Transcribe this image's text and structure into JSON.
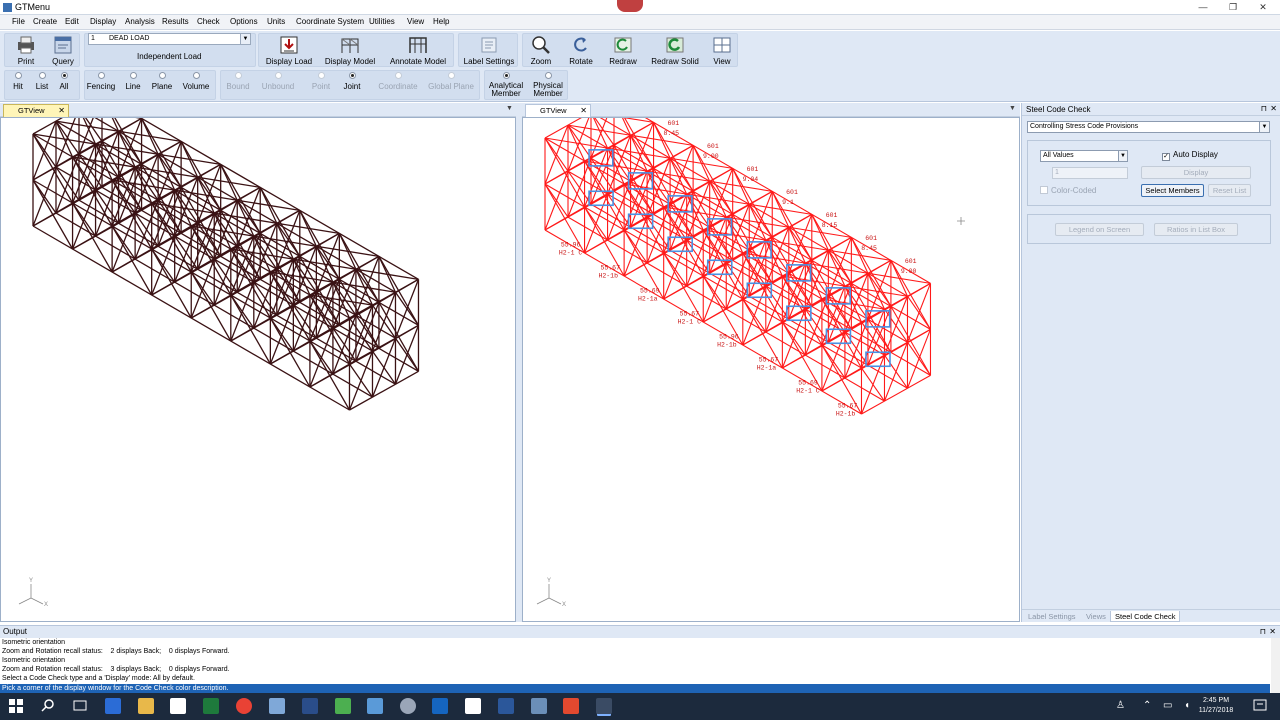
{
  "window": {
    "title": "GTMenu",
    "controls": [
      "—",
      "❐",
      "✕"
    ]
  },
  "menu": [
    "File",
    "Create",
    "Edit",
    "Display",
    "Analysis",
    "Results",
    "Check",
    "Options",
    "Units",
    "Coordinate System",
    "Utilities",
    "View",
    "Help"
  ],
  "toolbar": {
    "print": "Print",
    "query": "Query",
    "load_number": "1",
    "load_name": "DEAD LOAD",
    "load_type": "Independent Load",
    "display_load": "Display Load",
    "display_model": "Display Model",
    "annotate_model": "Annotate Model",
    "label_settings": "Label Settings",
    "zoom": "Zoom",
    "rotate": "Rotate",
    "redraw": "Redraw",
    "redraw_solid": "Redraw Solid",
    "view": "View"
  },
  "selection": {
    "hit": "Hit",
    "list": "List",
    "all": "All",
    "fencing": "Fencing",
    "line": "Line",
    "plane": "Plane",
    "volume": "Volume",
    "bound": "Bound",
    "unbound": "Unbound",
    "point": "Point",
    "joint": "Joint",
    "coordinate": "Coordinate",
    "global_plane": "Global Plane",
    "analytical_1": "Analytical",
    "analytical_2": "Member",
    "physical_1": "Physical",
    "physical_2": "Member",
    "selected": [
      "all",
      "joint",
      "analytical"
    ]
  },
  "views": {
    "left_tab": "GTView",
    "right_tab": "GTView",
    "axis_x": "X",
    "axis_y": "Y",
    "frame_color_left": "#3a1214",
    "frame_color_right": "#ff1a1a",
    "highlight_color": "#4a90e2",
    "check_labels": [
      "601",
      "8.15",
      "8.45",
      "9.00",
      "9.04",
      "9.1",
      "55.96",
      "55.67",
      "55.69",
      "55.67",
      "H2-1 C",
      "H2-1b",
      "H2-1a"
    ]
  },
  "code_check": {
    "title": "Steel Code Check",
    "provisions": "Controlling Stress Code Provisions",
    "values_select": "All Values",
    "auto_display": "Auto Display",
    "spin_value": "1",
    "display_btn": "Display",
    "color_coded": "Color-Coded",
    "select_members_btn": "Select Members",
    "reset_list_btn": "Reset List",
    "legend_btn": "Legend on Screen",
    "ratios_btn": "Ratios in List Box",
    "tabs": [
      "Label Settings",
      "Views",
      "Steel Code Check"
    ]
  },
  "output": {
    "title": "Output",
    "lines": [
      "Isometric orientation",
      "Zoom and Rotation recall status:    2 displays Back;    0 displays Forward.",
      "Isometric orientation",
      "Zoom and Rotation recall status:    3 displays Back;    0 displays Forward.",
      "Select a Code Check type and a 'Display' mode: All by default."
    ],
    "status": "Pick a corner of the display window for the Code Check color description."
  },
  "taskbar": {
    "time": "2:45 PM",
    "date": "11/27/2018"
  }
}
